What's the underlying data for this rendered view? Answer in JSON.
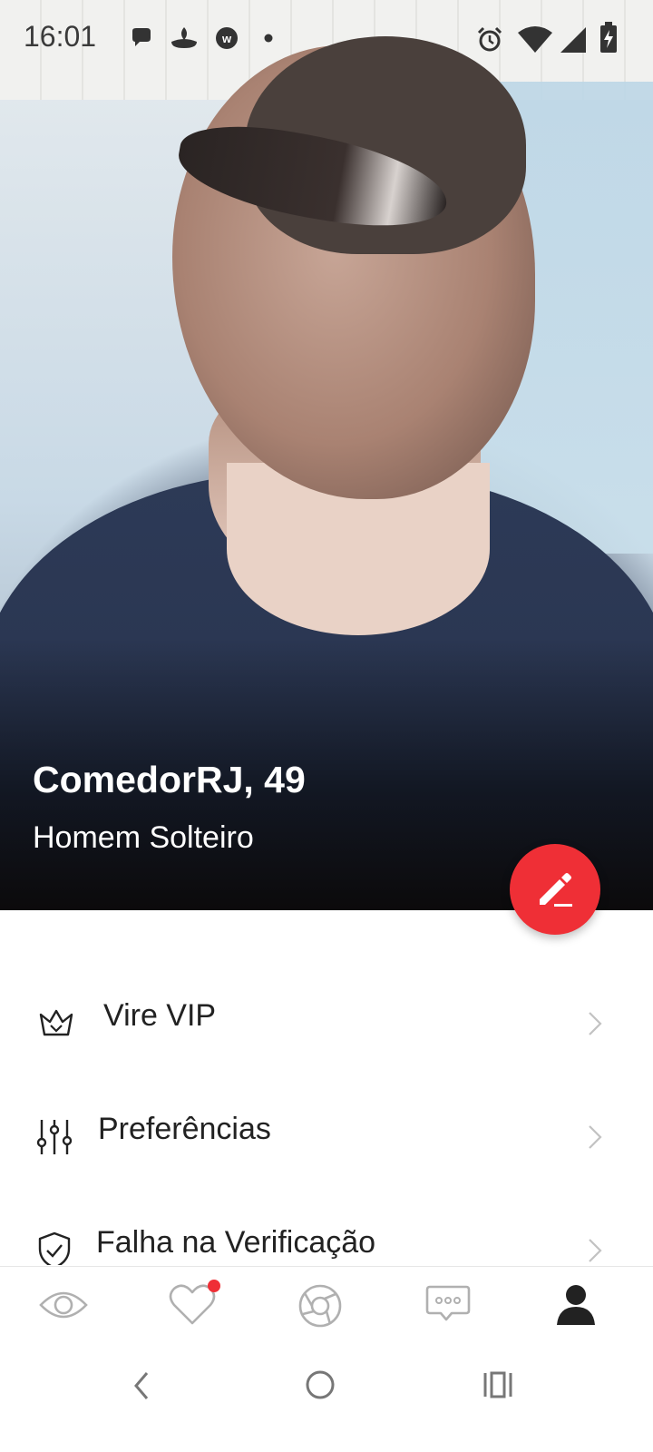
{
  "status_bar": {
    "time": "16:01",
    "icons": [
      "chat-bubble-icon",
      "santander-flame-icon",
      "w-circle-icon",
      "dot-icon",
      "alarm-icon",
      "wifi-icon",
      "signal-icon",
      "battery-charging-icon"
    ]
  },
  "profile": {
    "name_age": "ComedorRJ, 49",
    "status": "Homem Solteiro",
    "edit_icon": "pencil-icon"
  },
  "menu": [
    {
      "label": "Vire VIP",
      "icon": "crown-icon"
    },
    {
      "label": "Preferências",
      "icon": "sliders-icon"
    },
    {
      "label": "Falha na Verificação",
      "icon": "shield-check-icon"
    }
  ],
  "bottom_nav": [
    {
      "icon": "eye-icon",
      "active": false
    },
    {
      "icon": "heart-icon",
      "active": false,
      "badge": true
    },
    {
      "icon": "aperture-icon",
      "active": false
    },
    {
      "icon": "chat-icon",
      "active": false
    },
    {
      "icon": "person-icon",
      "active": true
    }
  ],
  "colors": {
    "accent": "#ef2f36",
    "nav_inactive": "#b0b0b0",
    "nav_active": "#222222"
  }
}
